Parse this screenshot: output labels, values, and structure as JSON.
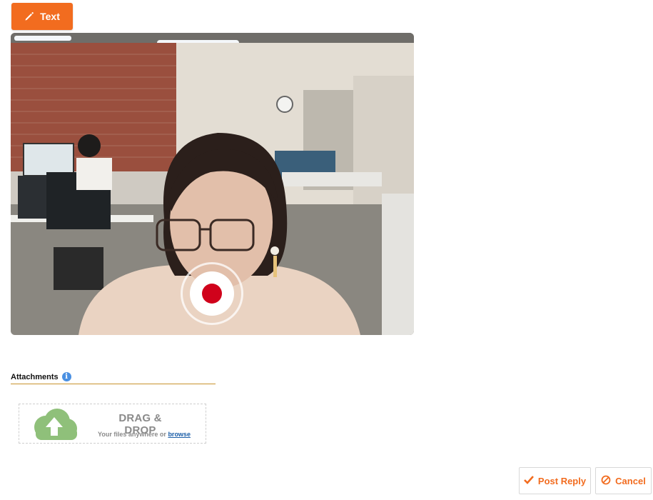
{
  "toolbar": {
    "text_label": "Text",
    "text_icon": "pencil-icon",
    "accent_color": "#f26c1f"
  },
  "video": {
    "record_icon": "record-icon",
    "record_color": "#d0021b"
  },
  "attachments": {
    "title": "Attachments",
    "info_icon": "info-icon",
    "divider_color": "#c8922c",
    "dropzone": {
      "title": "DRAG & DROP",
      "subtitle": "Your files anywhere or",
      "browse_label": "browse",
      "upload_icon": "cloud-upload-icon",
      "icon_color": "#8fc07a"
    }
  },
  "actions": {
    "post_label": "Post Reply",
    "post_icon": "check-icon",
    "cancel_label": "Cancel",
    "cancel_icon": "ban-icon"
  }
}
